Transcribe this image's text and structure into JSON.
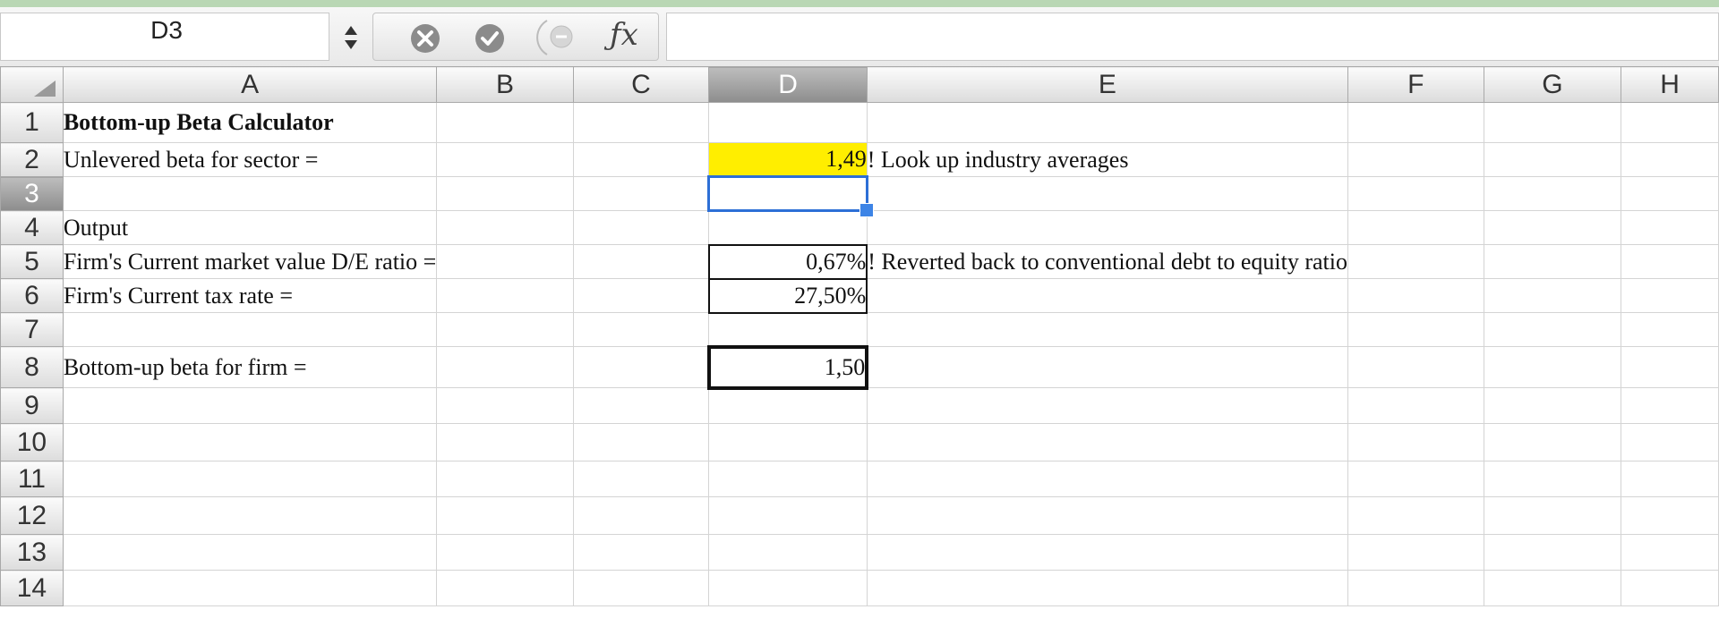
{
  "formula_bar": {
    "name_box": "D3",
    "formula": ""
  },
  "columns": [
    "A",
    "B",
    "C",
    "D",
    "E",
    "F",
    "G",
    "H"
  ],
  "active_column": "D",
  "active_row": 3,
  "rows": [
    {
      "num": "1",
      "a": "Bottom-up Beta Calculator",
      "d": "",
      "e": ""
    },
    {
      "num": "2",
      "a": "Unlevered beta for sector =",
      "d": "1,49",
      "e": "! Look up industry averages"
    },
    {
      "num": "3",
      "a": "",
      "d": "",
      "e": ""
    },
    {
      "num": "4",
      "a": "Output",
      "d": "",
      "e": ""
    },
    {
      "num": "5",
      "a": "Firm's Current market value D/E ratio =",
      "d": "0,67%",
      "e": "! Reverted back to conventional debt to equity ratio"
    },
    {
      "num": "6",
      "a": "Firm's Current tax rate =",
      "d": "27,50%",
      "e": ""
    },
    {
      "num": "7",
      "a": "",
      "d": "",
      "e": ""
    },
    {
      "num": "8",
      "a": "Bottom-up beta for firm =",
      "d": "1,50",
      "e": ""
    },
    {
      "num": "9",
      "a": "",
      "d": "",
      "e": ""
    },
    {
      "num": "10",
      "a": "",
      "d": "",
      "e": ""
    },
    {
      "num": "11",
      "a": "",
      "d": "",
      "e": ""
    },
    {
      "num": "12",
      "a": "",
      "d": "",
      "e": ""
    },
    {
      "num": "13",
      "a": "",
      "d": "",
      "e": ""
    },
    {
      "num": "14",
      "a": "",
      "d": "",
      "e": ""
    }
  ],
  "colors": {
    "input_fill": "#ffee00",
    "selection": "#2d6fd6"
  },
  "icons": [
    "stepper-icon",
    "cancel-icon",
    "confirm-icon",
    "function-icon"
  ]
}
